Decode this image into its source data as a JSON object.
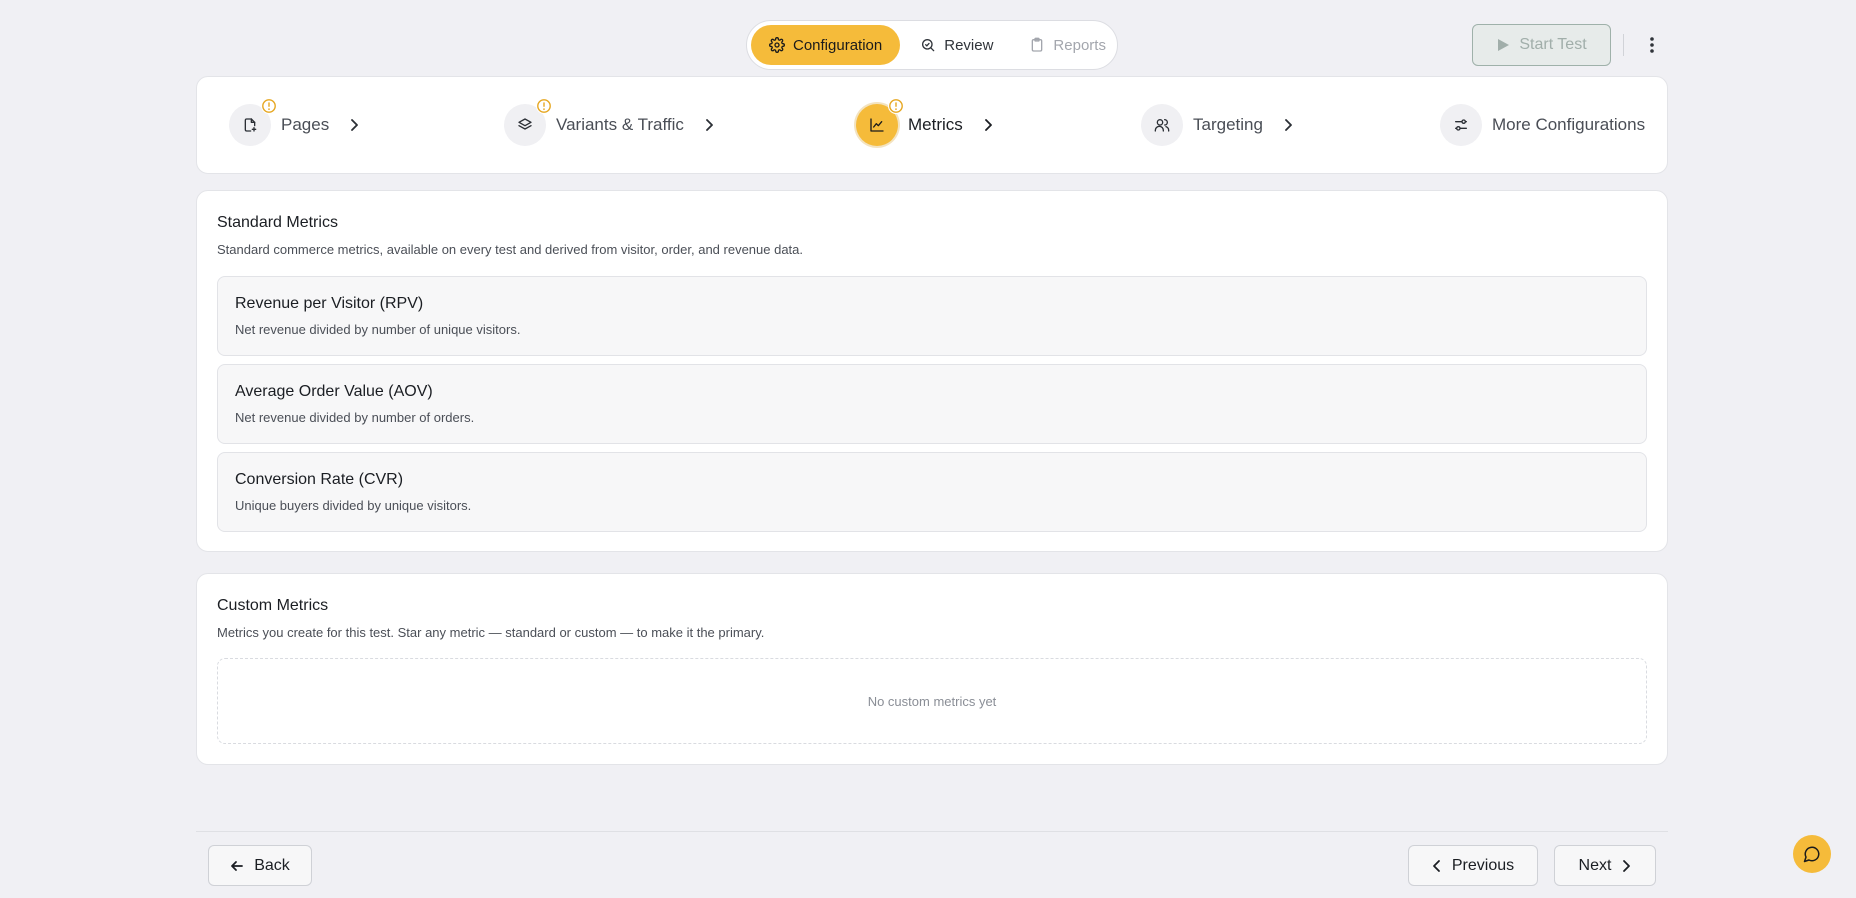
{
  "colors": {
    "accent": "#f5bb3a",
    "background": "#f0f0f4",
    "warning": "#e6a722"
  },
  "mode_tabs": [
    {
      "label": "Configuration",
      "icon": "gear-icon",
      "state": "active"
    },
    {
      "label": "Review",
      "icon": "review-search-icon",
      "state": "normal"
    },
    {
      "label": "Reports",
      "icon": "clipboard-icon",
      "state": "disabled"
    }
  ],
  "header": {
    "start_test_label": "Start Test"
  },
  "stepper": {
    "steps": [
      {
        "label": "Pages",
        "icon": "page-icon",
        "warning": true
      },
      {
        "label": "Variants & Traffic",
        "icon": "layers-icon",
        "warning": true
      },
      {
        "label": "Metrics",
        "icon": "chart-icon",
        "warning": true,
        "active": true
      },
      {
        "label": "Targeting",
        "icon": "users-icon",
        "warning": false
      },
      {
        "label": "More Configurations",
        "icon": "sliders-icon",
        "warning": false
      }
    ]
  },
  "standard": {
    "title": "Standard Metrics",
    "description": "Standard commerce metrics, available on every test and derived from visitor, order, and revenue data.",
    "metrics": [
      {
        "name": "Revenue per Visitor (RPV)",
        "description": "Net revenue divided by number of unique visitors."
      },
      {
        "name": "Average Order Value (AOV)",
        "description": "Net revenue divided by number of orders."
      },
      {
        "name": "Conversion Rate (CVR)",
        "description": "Unique buyers divided by unique visitors."
      }
    ]
  },
  "custom": {
    "title": "Custom Metrics",
    "description": "Metrics you create for this test. Star any metric — standard or custom — to make it the primary.",
    "empty_text": "No custom metrics yet"
  },
  "footer": {
    "back_label": "Back",
    "previous_label": "Previous",
    "next_label": "Next"
  }
}
